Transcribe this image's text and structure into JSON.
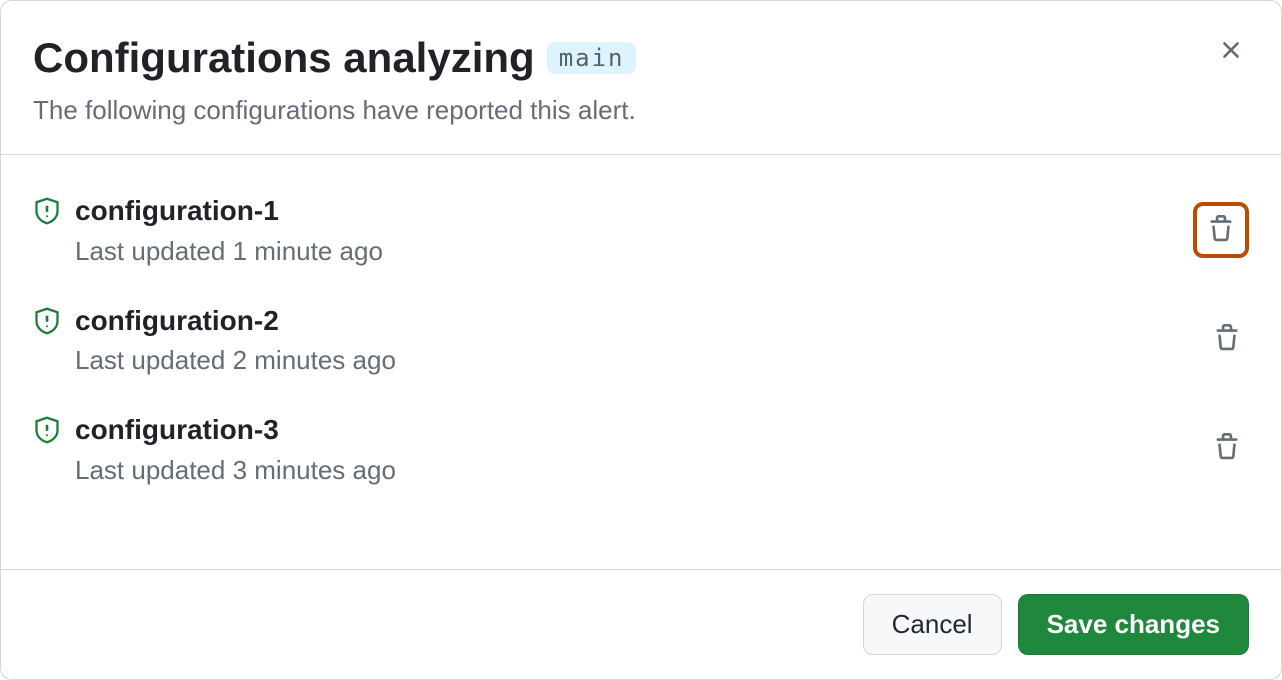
{
  "header": {
    "title": "Configurations analyzing",
    "branch": "main",
    "subtitle": "The following configurations have reported this alert."
  },
  "configurations": [
    {
      "name": "configuration-1",
      "updated": "Last updated 1 minute ago",
      "highlighted": true
    },
    {
      "name": "configuration-2",
      "updated": "Last updated 2 minutes ago",
      "highlighted": false
    },
    {
      "name": "configuration-3",
      "updated": "Last updated 3 minutes ago",
      "highlighted": false
    }
  ],
  "footer": {
    "cancel_label": "Cancel",
    "save_label": "Save changes"
  },
  "colors": {
    "highlight": "#bc4c00",
    "success": "#1a7f37",
    "primary_btn": "#1f883d"
  }
}
